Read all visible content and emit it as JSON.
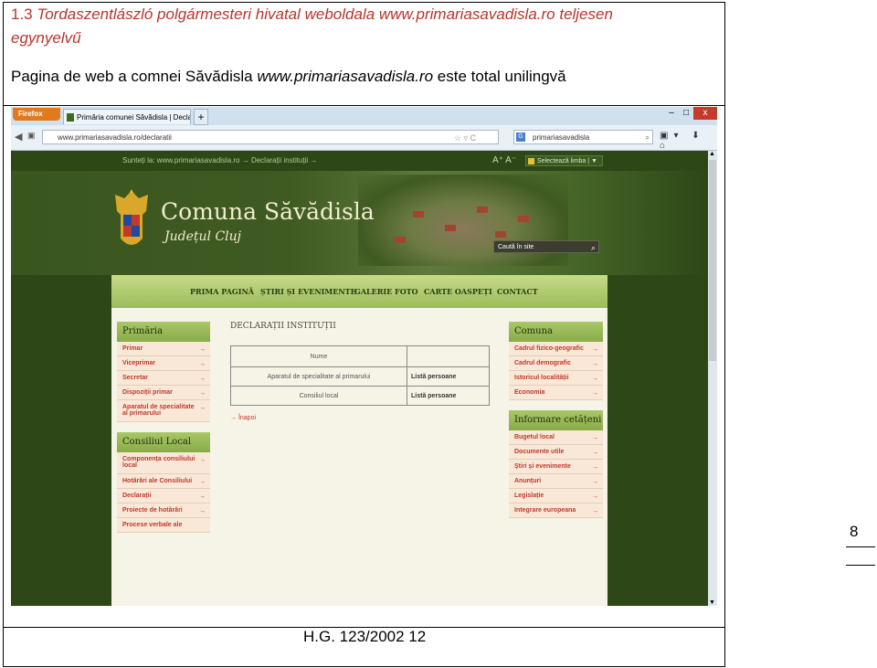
{
  "heading": {
    "number": "1.3",
    "title_hu": "Tordaszentlászló polgármesteri hivatal weboldala www.primariasavadisla.ro  teljesen",
    "title_hu_cont": "egynyelvű",
    "ro_prefix": "Pagina de web a comnei Săvădisla ",
    "ro_url": "www.primariasavadisla.ro",
    "ro_suffix": " este total unilingvă"
  },
  "footer": {
    "law": "H.G. 123/2002 12",
    "page_number": "8"
  },
  "browser": {
    "app_button": "Firefox",
    "tab_title": "Primăria comunei Săvădisla | Declarații i...",
    "tab_close": "×",
    "new_tab": "+",
    "url": "www.primariasavadisla.ro/declaratii",
    "search_value": "primariasavadisla",
    "search_engine": "G",
    "window_controls": [
      "–",
      "□",
      "x"
    ]
  },
  "site": {
    "topbar": {
      "breadcrumb": "Sunteți la:  www.primariasavadisla.ro  →  Declarații instituții  →",
      "font_controls": "A⁺  A⁻",
      "language": "Selectează limba | ▼"
    },
    "brand": "Comuna Săvădisla",
    "county": "Județul Cluj",
    "search_placeholder": "Caută în site",
    "menu": [
      "PRIMA PAGINĂ",
      "ȘTIRI ȘI EVENIMENTE",
      "GALERIE FOTO",
      "CARTE OASPEȚI",
      "CONTACT"
    ],
    "left": [
      {
        "title": "Primăria",
        "items": [
          "Primar",
          "Viceprimar",
          "Secretar",
          "Dispoziții primar",
          "Aparatul de specialitate al primarului"
        ]
      },
      {
        "title": "Consiliul Local",
        "items": [
          "Componența consiliului local",
          "Hotărâri ale Consiliului",
          "Declarații",
          "Proiecte de hotărâri",
          "Procese verbale ale"
        ]
      }
    ],
    "right": [
      {
        "title": "Comuna",
        "items": [
          "Cadrul fizico-geografic",
          "Cadrul demografic",
          "Istoricul localității",
          "Economia"
        ]
      },
      {
        "title": "Informare cetățeni",
        "items": [
          "Bugetul local",
          "Documente utile",
          "Știri și evenimente",
          "Anunțuri",
          "Legislație",
          "Integrare europeana"
        ]
      }
    ],
    "main": {
      "title": "DECLARAȚII INSTITUȚII",
      "table_header": "Nume",
      "rows": [
        {
          "name": "Aparatul de specialitate al primarului",
          "link": "Listă persoane"
        },
        {
          "name": "Consiliul local",
          "link": "Listă persoane"
        }
      ],
      "back": "Înapoi"
    }
  },
  "colors": {
    "heading_red": "#b8352b",
    "site_green": "#2d4717",
    "menu_green": "#9cbc5a",
    "link_red": "#c0392b"
  }
}
